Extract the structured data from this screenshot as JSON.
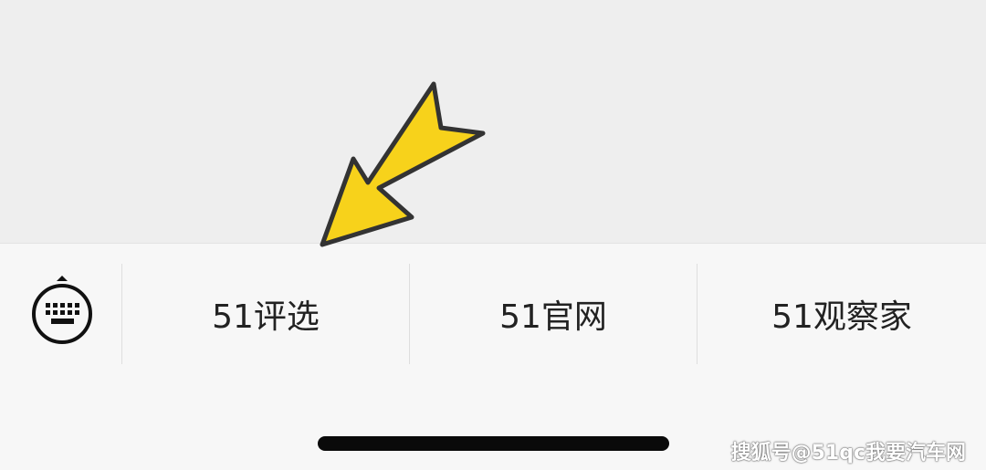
{
  "menu": {
    "items": [
      {
        "label": "51评选"
      },
      {
        "label": "51官网"
      },
      {
        "label": "51观察家"
      }
    ]
  },
  "icons": {
    "keyboard_switch": "keyboard-toggle-icon",
    "annotation": "yellow-arrow-icon"
  },
  "colors": {
    "arrow_fill": "#f7d21b",
    "arrow_stroke": "#333333",
    "menu_bg": "#f7f7f7",
    "top_bg": "#eeeeee"
  },
  "watermark": {
    "text": "搜狐号@51qc我要汽车网"
  }
}
